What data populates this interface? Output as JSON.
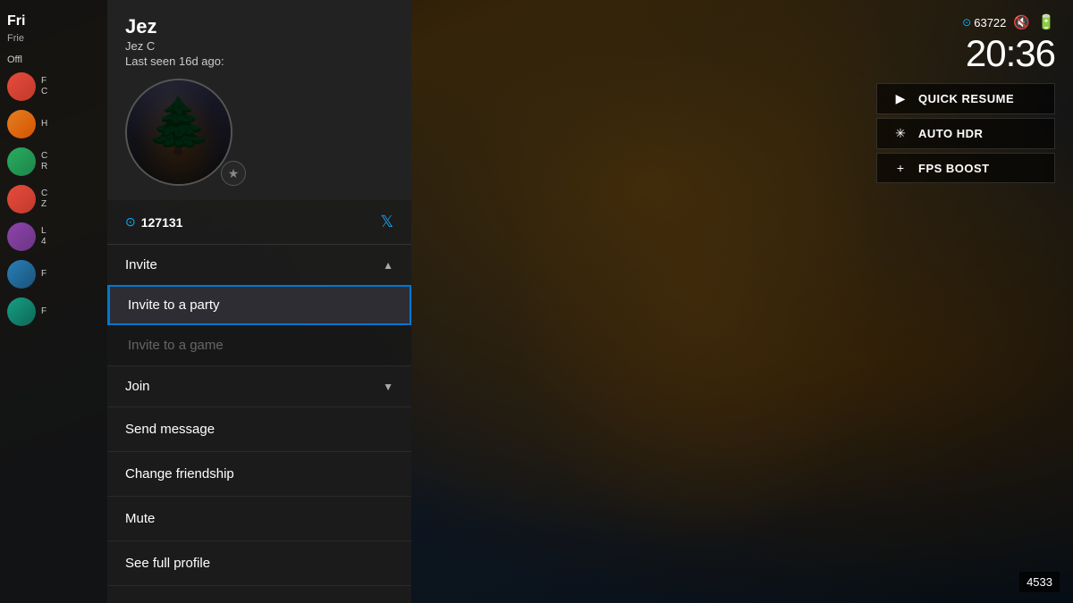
{
  "background": {
    "description": "Dark fantasy game scene - Elden Ring/Dark Souls style"
  },
  "sidebar": {
    "title": "Fri",
    "subtitle": "Frie",
    "section_label": "Offl",
    "items": [
      {
        "id": 1,
        "name": "F",
        "sub": "C",
        "avatar_class": "av1"
      },
      {
        "id": 2,
        "name": "H",
        "sub": "",
        "avatar_class": "av2"
      },
      {
        "id": 3,
        "name": "C",
        "sub": "R",
        "avatar_class": "av3"
      },
      {
        "id": 4,
        "name": "C",
        "sub": "Z",
        "avatar_class": "av1"
      },
      {
        "id": 5,
        "name": "L",
        "sub": "4",
        "avatar_class": "av4"
      },
      {
        "id": 6,
        "name": "F",
        "sub": "",
        "avatar_class": "av5"
      },
      {
        "id": 7,
        "name": "F",
        "sub": "",
        "avatar_class": "av6"
      }
    ]
  },
  "profile": {
    "name": "Jez",
    "gamertag": "Jez C",
    "last_seen_label": "Last seen 16d ago:",
    "gamerscore": "127131",
    "has_twitter": true
  },
  "invite_section": {
    "label": "Invite",
    "chevron": "▲",
    "items": [
      {
        "id": "invite-party",
        "label": "Invite to a party",
        "selected": true,
        "disabled": false
      },
      {
        "id": "invite-game",
        "label": "Invite to a game",
        "selected": false,
        "disabled": true
      }
    ]
  },
  "join_section": {
    "label": "Join",
    "chevron": "▼"
  },
  "menu_items": [
    {
      "id": "send-message",
      "label": "Send message"
    },
    {
      "id": "change-friendship",
      "label": "Change friendship"
    },
    {
      "id": "mute",
      "label": "Mute"
    },
    {
      "id": "see-full-profile",
      "label": "See full profile"
    }
  ],
  "hud": {
    "gamerscore": "63722",
    "time": "20:36",
    "quick_resume_label": "QUICK RESUME",
    "auto_hdr_label": "AUTO HDR",
    "fps_boost_label": "FPS BOOST"
  },
  "score": "4533"
}
